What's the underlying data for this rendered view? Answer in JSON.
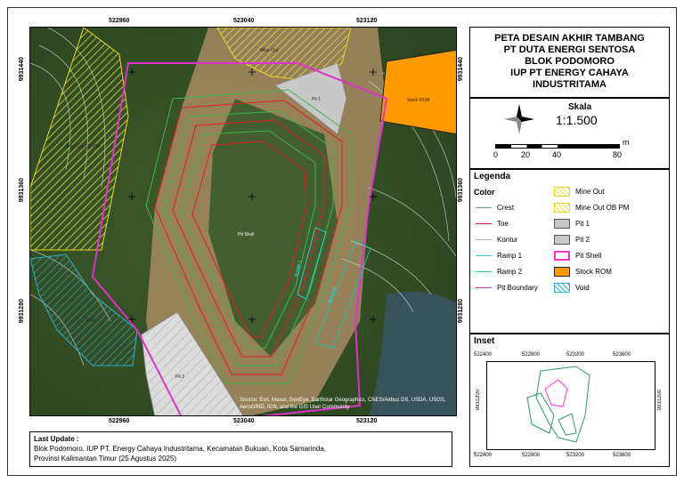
{
  "map": {
    "top_ticks": [
      "522960",
      "523040",
      "523120"
    ],
    "bottom_ticks": [
      "522960",
      "523040",
      "523120"
    ],
    "left_ticks": [
      "9931440",
      "9931360",
      "9931280"
    ],
    "right_ticks": [
      "9931440",
      "9931360",
      "9931280"
    ],
    "labels": {
      "mine_out": "Mine Out",
      "pit1": "Pit 1",
      "stock_rom": "Stock ROM",
      "mine_out_ob": "Mine Out OB PM",
      "pit_shell": "Pit Shell",
      "void": "Void",
      "pit2": "Pit 2",
      "ramp1": "RAMP 1",
      "ramp2": "RAMP 2"
    },
    "attribution": "Source: Esri, Maxar, GeoEye, Earthstar Geographics, CNES/Airbus DS, USDA, USGS, AeroGRID, IGN, and the GIS User Community"
  },
  "title": {
    "lines": [
      "PETA DESAIN AKHIR TAMBANG",
      "PT DUTA ENERGI SENTOSA",
      "BLOK PODOMORO",
      "IUP PT ENERGY CAHAYA",
      "INDUSTRITAMA"
    ]
  },
  "scale": {
    "heading": "Skala",
    "ratio": "1:1.500",
    "unit": "m",
    "ticks": [
      "0",
      "20",
      "40",
      "80"
    ]
  },
  "legend": {
    "heading": "Legenda",
    "color_heading": "Color",
    "lines": [
      {
        "label": "Crest",
        "color": "#3cb84a"
      },
      {
        "label": "Toe",
        "color": "#e02020"
      },
      {
        "label": "Kontur",
        "color": "#b0b0b0"
      },
      {
        "label": "Ramp 1",
        "color": "#30d0c0"
      },
      {
        "label": "Ramp 2",
        "color": "#20c0a0"
      },
      {
        "label": "Pit Boundary",
        "color": "#cc33cc"
      }
    ],
    "areas": [
      {
        "label": "Mine Out",
        "color": "#f0e040"
      },
      {
        "label": "Mine Out OB PM",
        "color": "#f0e040"
      },
      {
        "label": "Pit 1",
        "color": "#c8c8c8"
      },
      {
        "label": "Pit 2",
        "color": "#c8c8c8"
      },
      {
        "label": "Pit Shell",
        "color": "#ff33cc"
      },
      {
        "label": "Stock ROM",
        "color": "#ff9900"
      },
      {
        "label": "Void",
        "color": "#30b0d0"
      }
    ]
  },
  "inset": {
    "heading": "Inset",
    "top_ticks": [
      "522400",
      "522800",
      "523200",
      "523600"
    ],
    "bottom_ticks": [
      "522400",
      "522800",
      "523200",
      "523600"
    ],
    "left_tick": "9931200",
    "right_tick": "9931200"
  },
  "last_update": {
    "heading": "Last Update :",
    "line1": "Blok Podomoro, IUP PT. Energy Cahaya Industritama, Kecamatan Bukuan, Kota Samarinda,",
    "line2": "Provinsi Kalimantan Timur (25 Agustus 2025)"
  }
}
